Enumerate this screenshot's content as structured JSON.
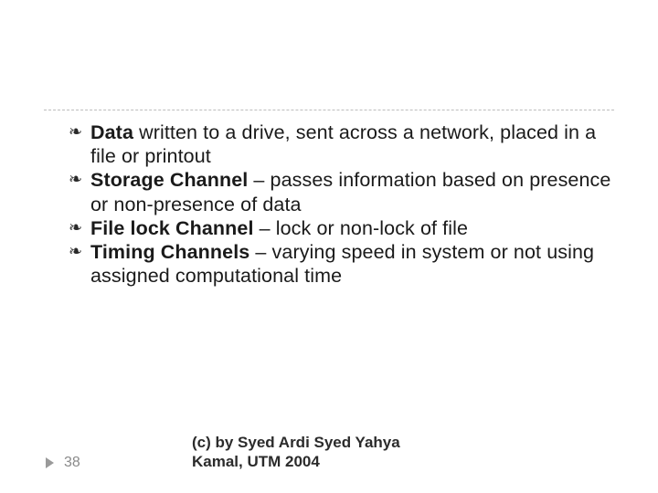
{
  "slide": {
    "bullets": [
      {
        "lead_bold": "Data",
        "rest": " written to a drive, sent across a network, placed in a file or printout"
      },
      {
        "lead_bold": "Storage Channel",
        "rest": " – passes information based on presence or non-presence of data"
      },
      {
        "lead_bold": "File lock Channel",
        "rest": " – lock or non-lock of file"
      },
      {
        "lead_bold": "Timing Channels",
        "rest": " – varying speed in system or not using assigned computational time"
      }
    ],
    "page_number": "38",
    "copyright_line1": "(c) by Syed Ardi Syed Yahya",
    "copyright_line2": "Kamal, UTM 2004"
  },
  "icons": {
    "bullet_glyph": "❧"
  }
}
